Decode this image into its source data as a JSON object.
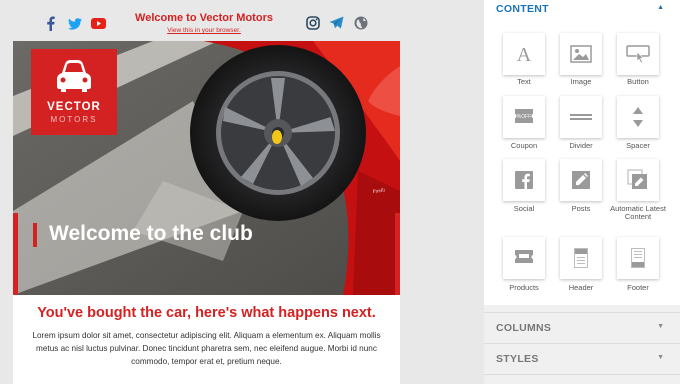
{
  "header": {
    "title": "Welcome to Vector Motors",
    "view_link": "View this in your browser.",
    "social_left": [
      "facebook-icon",
      "twitter-icon",
      "youtube-icon"
    ],
    "social_right": [
      "instagram-icon",
      "telegram-icon",
      "globe-icon"
    ]
  },
  "hero": {
    "logo_line1": "VECTOR",
    "logo_line2": "MOTORS",
    "headline": "Welcome to the club"
  },
  "body": {
    "heading": "You've bought the car, here's what happens next.",
    "text": "Lorem ipsum dolor sit amet, consectetur adipiscing elit. Aliquam a elementum ex. Aliquam mollis metus ac nisl luctus pulvinar. Donec tincidunt pharetra sem, nec eleifend augue. Morbi id nunc commodo, tempor erat et, pretium neque."
  },
  "panel": {
    "content_label": "CONTENT",
    "columns_label": "COLUMNS",
    "styles_label": "STYLES",
    "blocks": [
      {
        "label": "Text",
        "icon": "text-icon"
      },
      {
        "label": "Image",
        "icon": "image-icon"
      },
      {
        "label": "Button",
        "icon": "button-icon"
      },
      {
        "label": "Coupon",
        "icon": "coupon-icon"
      },
      {
        "label": "Divider",
        "icon": "divider-icon"
      },
      {
        "label": "Spacer",
        "icon": "spacer-icon"
      },
      {
        "label": "Social",
        "icon": "social-icon"
      },
      {
        "label": "Posts",
        "icon": "posts-icon"
      },
      {
        "label": "Automatic Latest Content",
        "icon": "automatic-latest-content-icon"
      },
      {
        "label": "Products",
        "icon": "products-icon"
      },
      {
        "label": "Header",
        "icon": "header-icon"
      },
      {
        "label": "Footer",
        "icon": "footer-icon"
      }
    ]
  },
  "colors": {
    "brand_red": "#d42121",
    "accent_blue": "#1a73b8",
    "panel_bg": "#f0f0f0"
  }
}
